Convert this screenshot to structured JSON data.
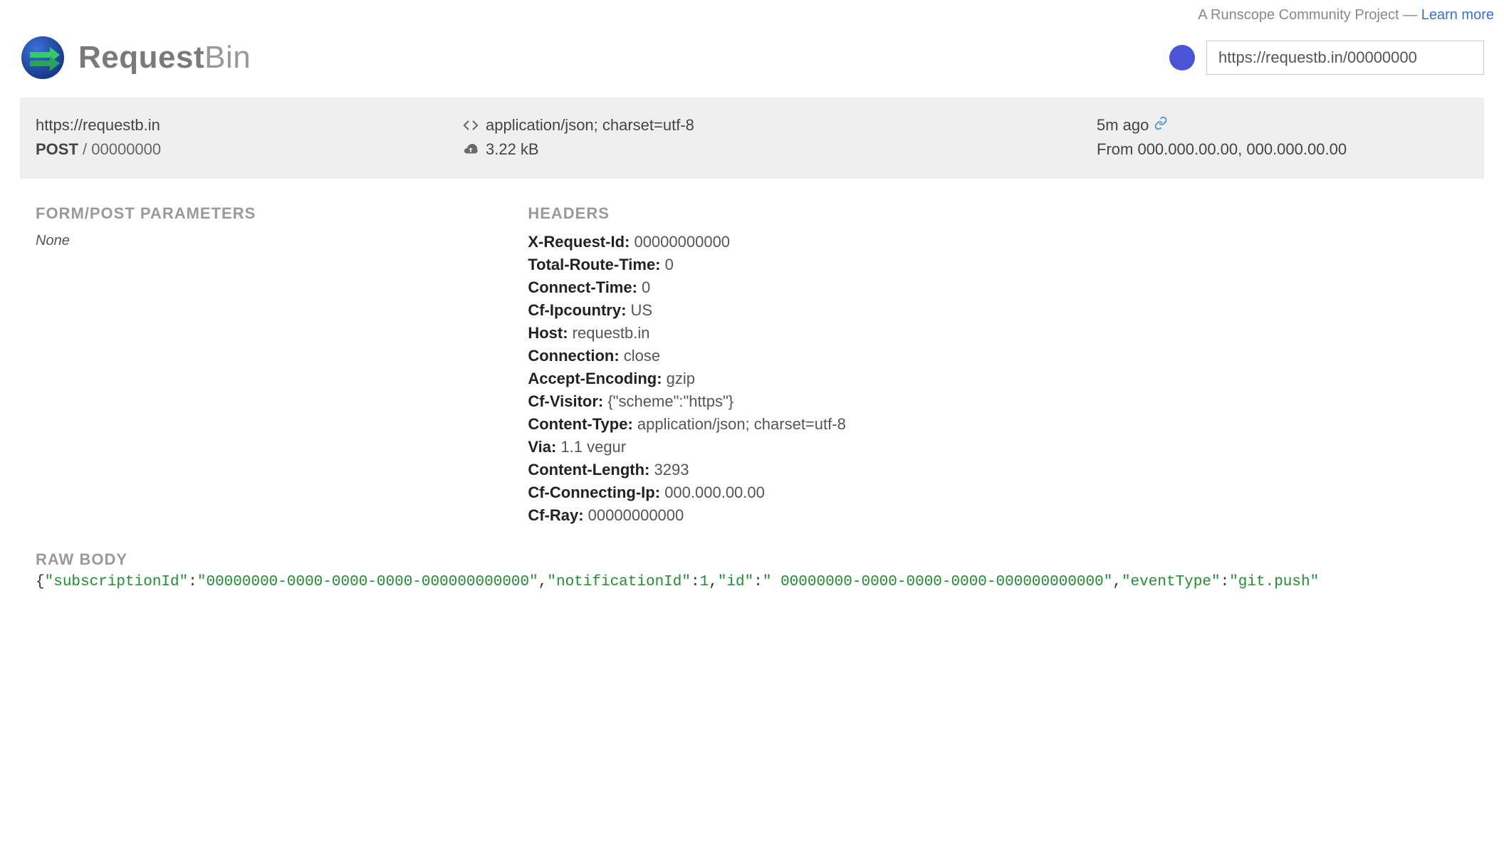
{
  "top_banner": {
    "text": "A Runscope Community Project — ",
    "link": "Learn more"
  },
  "brand": {
    "bold": "Request",
    "light": "Bin"
  },
  "header": {
    "bin_url": "https://requestb.in/00000000"
  },
  "summary": {
    "host": "https://requestb.in",
    "method": "POST",
    "path": "/ 00000000",
    "content_type": "application/json; charset=utf-8",
    "size": "3.22 kB",
    "time_ago": "5m ago",
    "from_label": "From",
    "from_ips": "000.000.00.00, 000.000.00.00"
  },
  "sections": {
    "form_title": "FORM/POST PARAMETERS",
    "form_none": "None",
    "headers_title": "HEADERS",
    "raw_title": "RAW BODY"
  },
  "headers": [
    {
      "name": "X-Request-Id:",
      "value": "00000000000"
    },
    {
      "name": "Total-Route-Time:",
      "value": "0"
    },
    {
      "name": "Connect-Time:",
      "value": "0"
    },
    {
      "name": "Cf-Ipcountry:",
      "value": "US"
    },
    {
      "name": "Host:",
      "value": "requestb.in"
    },
    {
      "name": "Connection:",
      "value": "close"
    },
    {
      "name": "Accept-Encoding:",
      "value": "gzip"
    },
    {
      "name": "Cf-Visitor:",
      "value": "{\"scheme\":\"https\"}"
    },
    {
      "name": "Content-Type:",
      "value": "application/json; charset=utf-8"
    },
    {
      "name": "Via:",
      "value": "1.1 vegur"
    },
    {
      "name": "Content-Length:",
      "value": "3293"
    },
    {
      "name": "Cf-Connecting-Ip:",
      "value": "000.000.00.00"
    },
    {
      "name": "Cf-Ray:",
      "value": "00000000000"
    }
  ],
  "raw_body": {
    "pairs": [
      {
        "k": "subscriptionId",
        "v": "00000000-0000-0000-0000-000000000000",
        "t": "str"
      },
      {
        "k": "notificationId",
        "v": "1",
        "t": "num"
      },
      {
        "k": "id",
        "v": " 00000000-0000-0000-0000-000000000000",
        "t": "str"
      },
      {
        "k": "eventType",
        "v": "git.push",
        "t": "str"
      }
    ]
  }
}
